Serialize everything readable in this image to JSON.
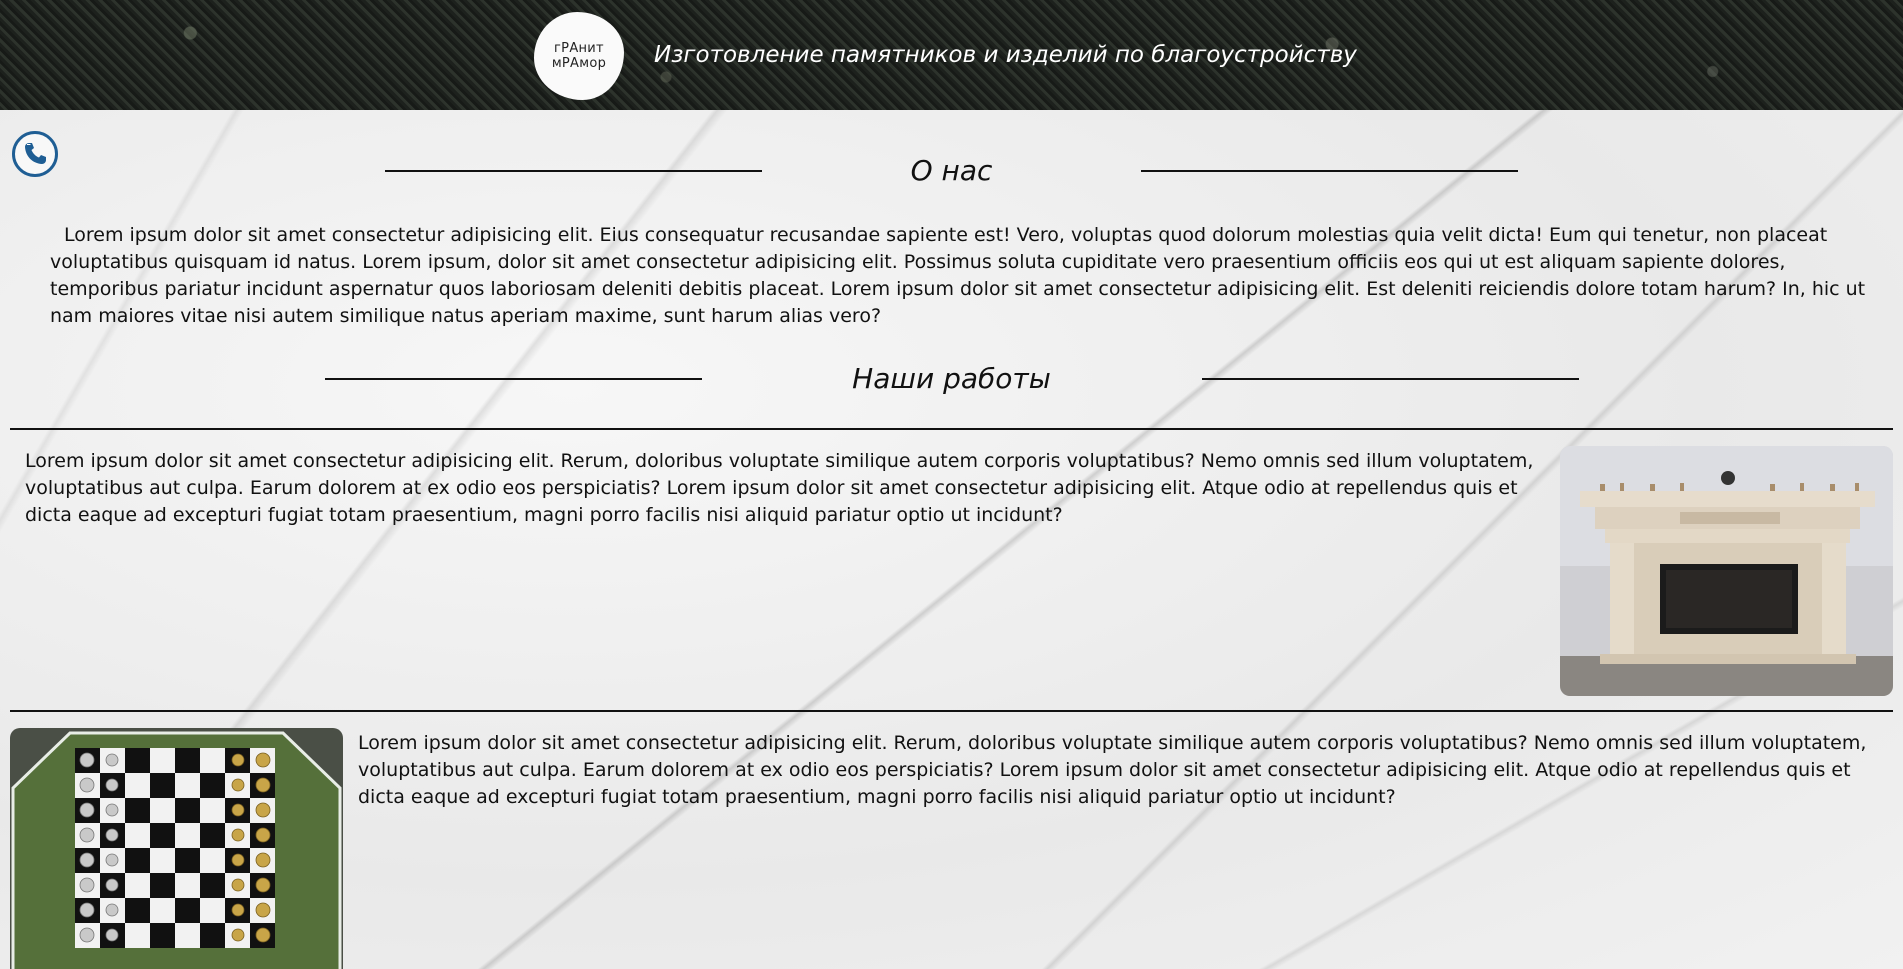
{
  "header": {
    "logo_line1": "гРАнит",
    "logo_line2": "мРАмор",
    "title": "Изготовление памятников и изделий по благоустройству"
  },
  "contact": {
    "icon": "phone-icon",
    "color": "#1f5e94"
  },
  "about": {
    "heading": "О нас",
    "text": "Lorem ipsum dolor sit amet consectetur adipisicing elit. Eius consequatur recusandae sapiente est! Vero, voluptas quod dolorum molestias quia velit dicta! Eum qui tenetur, non placeat voluptatibus quisquam id natus. Lorem ipsum, dolor sit amet consectetur adipisicing elit. Possimus soluta cupiditate vero praesentium officiis eos qui ut est aliquam sapiente dolores, temporibus pariatur incidunt aspernatur quos laboriosam deleniti debitis placeat. Lorem ipsum dolor sit amet consectetur adipisicing elit. Est deleniti reiciendis dolore totam harum? In, hic ut nam maiores vitae nisi autem similique natus aperiam maxime, sunt harum alias vero?"
  },
  "works": {
    "heading": "Наши работы",
    "items": [
      {
        "text": "Lorem ipsum dolor sit amet consectetur adipisicing elit. Rerum, doloribus voluptate similique autem corporis voluptatibus? Nemo omnis sed illum voluptatem, voluptatibus aut culpa. Earum dolorem at ex odio eos perspiciatis? Lorem ipsum dolor sit amet consectetur adipisicing elit. Atque odio at repellendus quis et dicta eaque ad excepturi fugiat totam praesentium, magni porro facilis nisi aliquid pariatur optio ut incidunt?",
        "image": "fireplace-photo"
      },
      {
        "text": "Lorem ipsum dolor sit amet consectetur adipisicing elit. Rerum, doloribus voluptate similique autem corporis voluptatibus? Nemo omnis sed illum voluptatem, voluptatibus aut culpa. Earum dolorem at ex odio eos perspiciatis? Lorem ipsum dolor sit amet consectetur adipisicing elit. Atque odio at repellendus quis et dicta eaque ad excepturi fugiat totam praesentium, magni porro facilis nisi aliquid pariatur optio ut incidunt?",
        "image": "chess-table-photo"
      }
    ]
  }
}
